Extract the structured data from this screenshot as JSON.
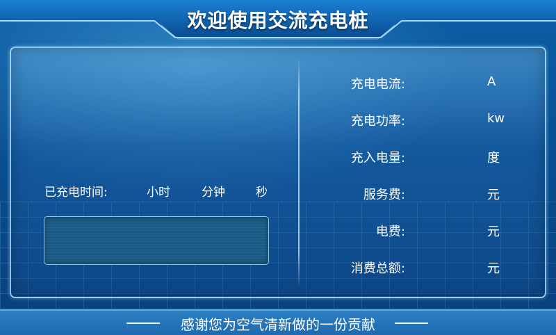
{
  "header": {
    "title": "欢迎使用交流充电桩"
  },
  "charging_time": {
    "label": "已充电时间:",
    "hours_unit": "小时",
    "minutes_unit": "分钟",
    "seconds_unit": "秒",
    "display_value": ""
  },
  "metrics": [
    {
      "label": "充电电流:",
      "unit": "A"
    },
    {
      "label": "充电功率:",
      "unit": "kw"
    },
    {
      "label": "充入电量:",
      "unit": "度"
    },
    {
      "label": "服务费:",
      "unit": "元"
    },
    {
      "label": "电费:",
      "unit": "元"
    },
    {
      "label": "消费总额:",
      "unit": "元"
    }
  ],
  "footer": {
    "slogan": "感谢您为空气清新做的一份贡献"
  },
  "colors": {
    "background": "#0a4f92",
    "panel_border": "#bee6ff",
    "display_fill": "#1c5c86",
    "footer_bar": "#2d7fc4"
  }
}
